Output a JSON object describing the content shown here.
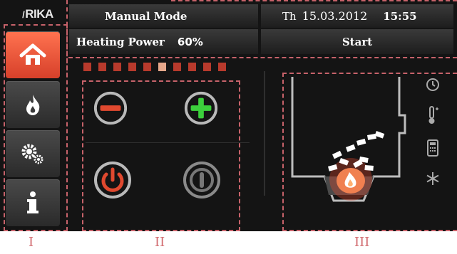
{
  "brand": {
    "logo_text": "RIKA"
  },
  "header": {
    "mode": "Manual Mode",
    "day": "Th",
    "date": "15.03.2012",
    "time": "15:55"
  },
  "power": {
    "label": "Heating Power",
    "value": "60%",
    "level_fraction": 0.6,
    "segments": 10
  },
  "start": {
    "label": "Start"
  },
  "sidebar": {
    "items": [
      {
        "name": "home",
        "active": true
      },
      {
        "name": "flame",
        "active": false
      },
      {
        "name": "settings",
        "active": false
      },
      {
        "name": "info",
        "active": false
      }
    ]
  },
  "controls": {
    "decrease": "minus-icon",
    "increase": "plus-icon",
    "power": "power-icon",
    "standby": "standby-icon"
  },
  "status_icons": [
    "clock-icon",
    "thermometer-icon",
    "remote-icon",
    "snowflake-icon"
  ],
  "regions": {
    "I": "I",
    "II": "II",
    "III": "III"
  },
  "colors": {
    "accent": "#e85a3c",
    "plus": "#3ccf3c",
    "dash": "#c7626a"
  }
}
